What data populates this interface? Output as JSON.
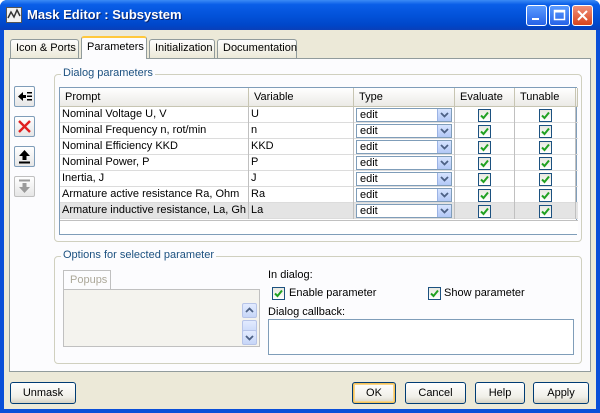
{
  "window": {
    "title": "Mask Editor : Subsystem"
  },
  "tabs": [
    {
      "label": "Icon & Ports"
    },
    {
      "label": "Parameters"
    },
    {
      "label": "Initialization"
    },
    {
      "label": "Documentation"
    }
  ],
  "dialog_parameters": {
    "title": "Dialog parameters",
    "columns": [
      "Prompt",
      "Variable",
      "Type",
      "Evaluate",
      "Tunable"
    ],
    "rows": [
      {
        "prompt": "Nominal Voltage U, V",
        "variable": "U",
        "type": "edit",
        "evaluate": true,
        "tunable": true
      },
      {
        "prompt": "Nominal Frequency n, rot/min",
        "variable": "n",
        "type": "edit",
        "evaluate": true,
        "tunable": true
      },
      {
        "prompt": "Nominal Efficiency KKD",
        "variable": "KKD",
        "type": "edit",
        "evaluate": true,
        "tunable": true
      },
      {
        "prompt": "Nominal Power, P",
        "variable": "P",
        "type": "edit",
        "evaluate": true,
        "tunable": true
      },
      {
        "prompt": "Inertia, J",
        "variable": "J",
        "type": "edit",
        "evaluate": true,
        "tunable": true
      },
      {
        "prompt": "Armature active resistance Ra, Ohm",
        "variable": "Ra",
        "type": "edit",
        "evaluate": true,
        "tunable": true
      },
      {
        "prompt": "Armature inductive resistance, La, Gh",
        "variable": "La",
        "type": "edit",
        "evaluate": true,
        "tunable": true
      }
    ]
  },
  "side_buttons": [
    {
      "icon": "add-parameter-icon",
      "enabled": true
    },
    {
      "icon": "delete-icon",
      "enabled": true
    },
    {
      "icon": "move-up-icon",
      "enabled": true
    },
    {
      "icon": "move-down-icon",
      "enabled": false
    }
  ],
  "options": {
    "title": "Options for selected parameter",
    "popups_label": "Popups",
    "in_dialog_label": "In dialog:",
    "enable_parameter_label": "Enable parameter",
    "enable_parameter_checked": true,
    "show_parameter_label": "Show parameter",
    "show_parameter_checked": true,
    "dialog_callback_label": "Dialog callback:",
    "dialog_callback_value": ""
  },
  "footer": {
    "unmask": "Unmask",
    "ok": "OK",
    "cancel": "Cancel",
    "help": "Help",
    "apply": "Apply"
  },
  "colors": {
    "titlebar": "#0251d8",
    "dialog_bg": "#ece9d8",
    "panel_bg": "#fcfcfe",
    "check_mark": "#21a121",
    "delete_red": "#e02020",
    "group_title": "#1c5180"
  }
}
